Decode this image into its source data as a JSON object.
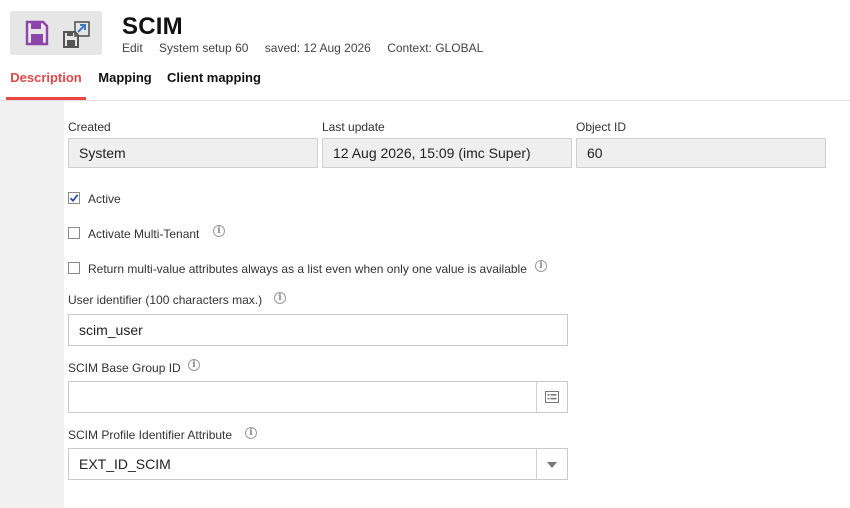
{
  "header": {
    "title": "SCIM",
    "meta": {
      "mode": "Edit",
      "object": "System setup 60",
      "saved": "saved: 12 Aug 2026",
      "context": "Context: GLOBAL"
    }
  },
  "toolbar": {
    "save_icon": "floppy-disk-icon",
    "save_as_icon": "save-as-export-icon"
  },
  "tabs": [
    {
      "label": "Description",
      "active": true
    },
    {
      "label": "Mapping",
      "active": false
    },
    {
      "label": "Client mapping",
      "active": false
    }
  ],
  "info_fields": {
    "created": {
      "label": "Created",
      "value": "System"
    },
    "last_update": {
      "label": "Last update",
      "value": "12 Aug 2026, 15:09 (imc Super)"
    },
    "object_id": {
      "label": "Object ID",
      "value": "60"
    }
  },
  "checkboxes": {
    "active": {
      "label": "Active",
      "checked": true
    },
    "multi_tenant": {
      "label": "Activate Multi-Tenant",
      "checked": false
    },
    "multi_value": {
      "label": "Return multi-value attributes always as a list even when only one value is available",
      "checked": false
    }
  },
  "fields": {
    "user_identifier": {
      "label": "User identifier (100 characters max.)",
      "value": "scim_user"
    },
    "base_group": {
      "label": "SCIM Base Group ID",
      "value": ""
    },
    "profile_attr": {
      "label": "SCIM Profile Identifier Attribute",
      "value": "EXT_ID_SCIM"
    }
  },
  "colors": {
    "accent": "#e84646",
    "save_icon": "#8e44ad",
    "save_as_icon": "#3a78c2"
  }
}
